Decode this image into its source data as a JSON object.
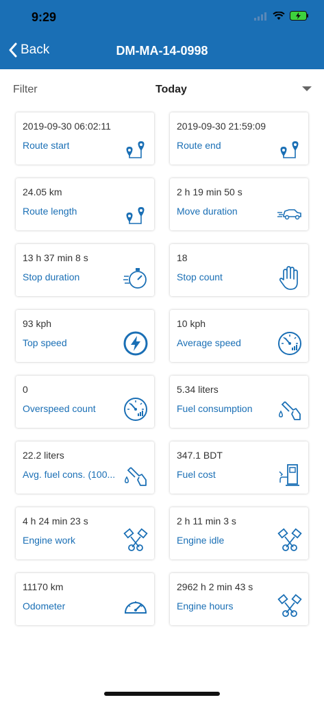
{
  "status": {
    "time": "9:29"
  },
  "nav": {
    "back_label": "Back",
    "title": "DM-MA-14-0998"
  },
  "filter": {
    "label": "Filter",
    "value": "Today"
  },
  "colors": {
    "header": "#1a6fb5",
    "accent": "#1a6fb5"
  },
  "cards": [
    {
      "value": "2019-09-30 06:02:11",
      "label": "Route start",
      "icon": "route-pin-icon"
    },
    {
      "value": "2019-09-30 21:59:09",
      "label": "Route end",
      "icon": "route-pin-icon"
    },
    {
      "value": "24.05 km",
      "label": "Route length",
      "icon": "route-pin-icon"
    },
    {
      "value": "2 h 19 min 50 s",
      "label": "Move duration",
      "icon": "moving-car-icon"
    },
    {
      "value": "13 h 37 min 8 s",
      "label": "Stop duration",
      "icon": "stopwatch-icon"
    },
    {
      "value": "18",
      "label": "Stop count",
      "icon": "hand-stop-icon"
    },
    {
      "value": "93 kph",
      "label": "Top speed",
      "icon": "lightning-circle-icon"
    },
    {
      "value": "10 kph",
      "label": "Average speed",
      "icon": "speed-gauge-icon"
    },
    {
      "value": "0",
      "label": "Overspeed count",
      "icon": "speed-gauge-icon"
    },
    {
      "value": "5.34 liters",
      "label": "Fuel consumption",
      "icon": "fuel-nozzle-icon"
    },
    {
      "value": "22.2 liters",
      "label": "Avg. fuel cons. (100...",
      "icon": "fuel-nozzle-icon"
    },
    {
      "value": "347.1 BDT",
      "label": "Fuel cost",
      "icon": "fuel-pump-icon"
    },
    {
      "value": "4 h 24 min 23 s",
      "label": "Engine work",
      "icon": "engine-pistons-icon"
    },
    {
      "value": "2 h 11 min 3 s",
      "label": "Engine idle",
      "icon": "engine-pistons-icon"
    },
    {
      "value": "11170 km",
      "label": "Odometer",
      "icon": "odometer-icon"
    },
    {
      "value": "2962 h 2 min 43 s",
      "label": "Engine hours",
      "icon": "engine-pistons-icon"
    }
  ]
}
